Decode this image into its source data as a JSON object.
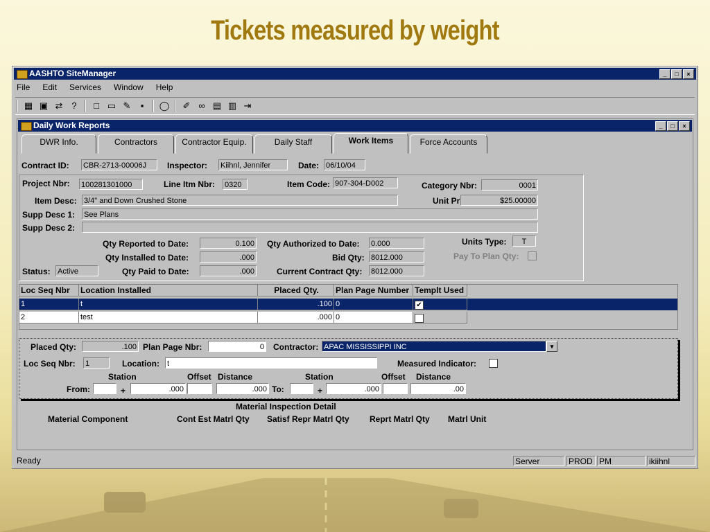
{
  "slide": {
    "title": "Tickets measured by weight"
  },
  "app": {
    "title": "AASHTO SiteManager",
    "menu": [
      "File",
      "Edit",
      "Services",
      "Window",
      "Help"
    ],
    "window_controls": {
      "minimize": "_",
      "restore": "□",
      "close": "×"
    }
  },
  "dwr": {
    "title": "Daily Work Reports",
    "tabs": [
      "DWR Info.",
      "Contractors",
      "Contractor Equip.",
      "Daily Staff",
      "Work Items",
      "Force Accounts"
    ],
    "active_tab": "Work Items",
    "contract_id_label": "Contract ID:",
    "contract_id": "CBR-2713-00006J",
    "inspector_label": "Inspector:",
    "inspector": "Kiihnl, Jennifer",
    "date_label": "Date:",
    "date": "06/10/04",
    "project_nbr_label": "Project Nbr:",
    "project_nbr": "100281301000",
    "line_itm_label": "Line Itm Nbr:",
    "line_itm": "0320",
    "item_code_label": "Item Code:",
    "item_code": "907-304-D002",
    "category_label": "Category Nbr:",
    "category": "0001",
    "item_desc_label": "Item Desc:",
    "item_desc": "3/4\" and Down Crushed Stone",
    "unit_price_label": "Unit Price:",
    "unit_price": "$25.00000",
    "supp1_label": "Supp Desc 1:",
    "supp1": "See Plans",
    "supp2_label": "Supp Desc 2:",
    "supp2": "",
    "qty_reported_label": "Qty Reported to Date:",
    "qty_reported": "0.100",
    "qty_installed_label": "Qty Installed to Date:",
    "qty_installed": ".000",
    "qty_paid_label": "Qty Paid to Date:",
    "qty_paid": ".000",
    "qty_auth_label": "Qty Authorized to Date:",
    "qty_auth": "0.000",
    "bid_qty_label": "Bid Qty:",
    "bid_qty": "8012.000",
    "current_qty_label": "Current Contract Qty:",
    "current_qty": "8012.000",
    "units_type_label": "Units Type:",
    "units_type": "T",
    "pay_to_plan_label": "Pay To Plan Qty:",
    "status_label": "Status:",
    "status": "Active"
  },
  "locations": {
    "headers": [
      "Loc Seq Nbr",
      "Location Installed",
      "Placed Qty.",
      "Plan Page Number",
      "Templt Used"
    ],
    "rows": [
      {
        "seq": "1",
        "location": "t",
        "placed": ".100",
        "plan_page": "0",
        "templt": "✔"
      },
      {
        "seq": "2",
        "location": "test",
        "placed": ".000",
        "plan_page": "0",
        "templt": ""
      }
    ]
  },
  "detail": {
    "placed_qty_label": "Placed Qty:",
    "placed_qty": ".100",
    "plan_page_label": "Plan Page Nbr:",
    "plan_page": "0",
    "contractor_label": "Contractor:",
    "contractor": "APAC MISSISSIPPI INC",
    "loc_seq_label": "Loc Seq Nbr:",
    "loc_seq": "1",
    "location_label": "Location:",
    "location": "t",
    "measured_label": "Measured Indicator:",
    "station_label": "Station",
    "offset_label": "Offset",
    "distance_label": "Distance",
    "from_label": "From:",
    "to_label": "To:",
    "plus": "+",
    "from_station": ".000",
    "from_distance": ".000",
    "to_station": ".000",
    "to_distance": ".00"
  },
  "material": {
    "title": "Material Inspection Detail",
    "headers": [
      "Material Component",
      "Cont Est Matrl Qty",
      "Satisf Repr Matrl Qty",
      "Reprt Matrl Qty",
      "Matrl Unit"
    ]
  },
  "status_bar": {
    "message": "Ready",
    "server": "Server",
    "db": "PROD",
    "ampm": "PM",
    "user": "ikiihnl"
  }
}
